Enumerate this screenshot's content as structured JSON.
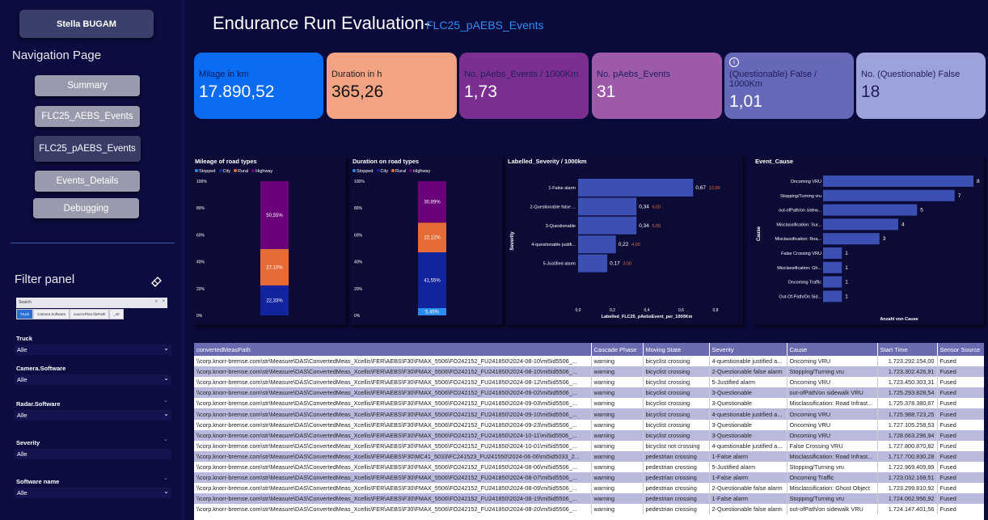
{
  "user": {
    "name": "Stella BUGAM"
  },
  "navigation": {
    "title": "Navigation Page",
    "items": [
      "Summary",
      "FLC25_AEBS_Events",
      "FLC25_pAEBS_Events",
      "Events_Details",
      "Debugging"
    ]
  },
  "header": {
    "title": "Endurance Run Evaluation-",
    "subtitle": "FLC25_pAEBS_Events"
  },
  "kpis": [
    {
      "label": "Milage in km",
      "value": "17.890,52",
      "color": "#0a6cf0"
    },
    {
      "label": "Duration in h",
      "value": "365,26",
      "color": "#f2a383"
    },
    {
      "label": "No. pAebs_Events / 1000Km",
      "value": "1,73",
      "color": "#7b2f90"
    },
    {
      "label": "No. pAebs_Events",
      "value": "31",
      "color": "#9d5aa9"
    },
    {
      "label": "(Questionable) False / 1000Km",
      "value": "1,01",
      "color": "#6669b9"
    },
    {
      "label": "No. (Questionable) False",
      "value": "18",
      "color": "#9ca2da"
    }
  ],
  "filters": {
    "title": "Filter panel",
    "search_placeholder": "Search",
    "chips": [
      "Truck",
      "Camera.Software",
      "sourceFiles.filePath",
      "_str"
    ],
    "fields": [
      {
        "label": "Truck",
        "value": "Alle"
      },
      {
        "label": "Camera.Software",
        "value": "Alle"
      },
      {
        "label": "Radar.Software",
        "value": "Alle"
      },
      {
        "label": "Severity",
        "value": "Alle"
      },
      {
        "label": "Software name",
        "value": "Alle"
      }
    ]
  },
  "colors": {
    "stopped": "#2b8cf0",
    "city": "#12239e",
    "rural": "#e66c37",
    "highway": "#6b007b",
    "bar": "#3c4fb3"
  },
  "chart_data": [
    {
      "type": "bar",
      "title": "Mileage of road types",
      "legend": [
        "Stopped",
        "City",
        "Rural",
        "Highway"
      ],
      "yticks": [
        "0%",
        "20%",
        "40%",
        "60%",
        "80%",
        "100%"
      ],
      "series": [
        {
          "name": "Stopped",
          "value": 0
        },
        {
          "name": "City",
          "value": 22.33,
          "label": "22,33%"
        },
        {
          "name": "Rural",
          "value": 27.1,
          "label": "27,10%"
        },
        {
          "name": "Highway",
          "value": 50.55,
          "label": "50,55%"
        }
      ]
    },
    {
      "type": "bar",
      "title": "Duration on road types",
      "legend": [
        "Stopped",
        "City",
        "Rural",
        "Highway"
      ],
      "yticks": [
        "0%",
        "20%",
        "40%",
        "60%",
        "80%",
        "100%"
      ],
      "series": [
        {
          "name": "Stopped",
          "value": 5.45,
          "label": "5,45%"
        },
        {
          "name": "City",
          "value": 41.55,
          "label": "41,55%"
        },
        {
          "name": "Rural",
          "value": 22.12,
          "label": "22,12%"
        },
        {
          "name": "Highway",
          "value": 30.89,
          "label": "30,89%"
        }
      ]
    },
    {
      "type": "bar",
      "title": "Labelled_Severity / 1000km",
      "xlabel": "Labelled_FLC25_pAebsEvent_per_1000Km",
      "ylabel": "Severity",
      "xlim": [
        0,
        0.8
      ],
      "xticks": [
        "0,0",
        "0,2",
        "0,4",
        "0,6",
        "0,8"
      ],
      "categories": [
        "1-False alarm",
        "2-Questionable false ...",
        "3-Questionable",
        "4-questionable justifi...",
        "5-Justified alarm"
      ],
      "values": [
        0.67,
        0.34,
        0.34,
        0.22,
        0.17
      ],
      "labels": [
        "0,67",
        "0,34",
        "0,34",
        "0,22",
        "0,17"
      ],
      "secondary_labels": [
        "12,00",
        "6,00",
        "6,00",
        "4,00",
        "3,00"
      ]
    },
    {
      "type": "bar",
      "title": "Event_Cause",
      "xlabel": "Anzahl von Cause",
      "ylabel": "Cause",
      "xlim": [
        0,
        8
      ],
      "categories": [
        "Oncoming VRU",
        "Stopping/Turning vru",
        "out-ofPath/on sidew...",
        "Misclassification: Sur...",
        "Misclassification: Roa...",
        "False Crossing VRU",
        "Misclassification: Gh...",
        "Oncoming Traffic",
        "Out-Of-Path/On Sid..."
      ],
      "values": [
        8,
        7,
        5,
        4,
        3,
        1,
        1,
        1,
        1
      ]
    }
  ],
  "table": {
    "columns": [
      "convertedMeasPath",
      "Cascade Phase",
      "Moving State",
      "Severity",
      "Cause",
      "Start Time",
      "Sensor Source"
    ],
    "rows": [
      [
        "\\\\corp.knorr-bremse.com\\str\\Measure\\DAS\\ConvertedMeas_Xcellis\\FER\\AEBS\\F30\\FMAX_5506\\FO242152_FU241850\\2024-08-10\\mi5id5506_...",
        "warning",
        "bicyclist crossing",
        "4-questionable justified a...",
        "Oncoming VRU",
        "1.723.292.154,00",
        "Fused"
      ],
      [
        "\\\\corp.knorr-bremse.com\\str\\Measure\\DAS\\ConvertedMeas_Xcellis\\FER\\AEBS\\F30\\FMAX_5506\\FO242152_FU241850\\2024-08-10\\mi5id5506_...",
        "warning",
        "bicyclist crossing",
        "2-Questionable false alarm",
        "Stopping/Turning vru",
        "1.723.302.426,91",
        "Fused"
      ],
      [
        "\\\\corp.knorr-bremse.com\\str\\Measure\\DAS\\ConvertedMeas_Xcellis\\FER\\AEBS\\F30\\FMAX_5506\\FO242152_FU241850\\2024-08-12\\mi5id5506_...",
        "warning",
        "bicyclist crossing",
        "5-Justified alarm",
        "Oncoming VRU",
        "1.723.450.303,31",
        "Fused"
      ],
      [
        "\\\\corp.knorr-bremse.com\\str\\Measure\\DAS\\ConvertedMeas_Xcellis\\FER\\AEBS\\F30\\FMAX_5506\\FO242152_FU241850\\2024-09-02\\mi5id5506_...",
        "warning",
        "bicyclist crossing",
        "3-Questionable",
        "out-ofPath/on sidewalk VRU",
        "1.725.293.828,54",
        "Fused"
      ],
      [
        "\\\\corp.knorr-bremse.com\\str\\Measure\\DAS\\ConvertedMeas_Xcellis\\FER\\AEBS\\F30\\FMAX_5506\\FO242152_FU241850\\2024-09-03\\mi5id5506_...",
        "warning",
        "bicyclist crossing",
        "3-Questionable",
        "Misclassification: Road Infrast...",
        "1.725.378.380,67",
        "Fused"
      ],
      [
        "\\\\corp.knorr-bremse.com\\str\\Measure\\DAS\\ConvertedMeas_Xcellis\\FER\\AEBS\\F30\\FMAX_5506\\FO242152_FU241850\\2024-09-10\\mi5id5506_...",
        "warning",
        "bicyclist crossing",
        "4-questionable justified a...",
        "Oncoming VRU",
        "1.725.988.723,25",
        "Fused"
      ],
      [
        "\\\\corp.knorr-bremse.com\\str\\Measure\\DAS\\ConvertedMeas_Xcellis\\FER\\AEBS\\F30\\FMAX_5506\\FO242152_FU241850\\2024-09-23\\mi5id5506_...",
        "warning",
        "bicyclist crossing",
        "3-Questionable",
        "Oncoming VRU",
        "1.727.105.258,53",
        "Fused"
      ],
      [
        "\\\\corp.knorr-bremse.com\\str\\Measure\\DAS\\ConvertedMeas_Xcellis\\FER\\AEBS\\F30\\FMAX_5506\\FO242152_FU241850\\2024-10-11\\mi5id5506_...",
        "warning",
        "bicyclist crossing",
        "3-Questionable",
        "Oncoming VRU",
        "1.728.663.296,94",
        "Fused"
      ],
      [
        "\\\\corp.knorr-bremse.com\\str\\Measure\\DAS\\ConvertedMeas_Xcellis\\FER\\AEBS\\F30\\FMAX_5506\\FO242152_FU241850\\2024-10-01\\mi5id5506_...",
        "warning",
        "bicyclist not crossing",
        "4-questionable justified a...",
        "False Crossing VRU",
        "1.727.800.870,82",
        "Fused"
      ],
      [
        "\\\\corp.knorr-bremse.com\\str\\Measure\\DAS\\ConvertedMeas_Xcellis\\FER\\AEBS\\F30\\MC41_5033\\FC241523_FU241550\\2024-06-06\\mi5id5033_2...",
        "warning",
        "pedestrian crossing",
        "1-False alarm",
        "Misclassification: Road Infrast...",
        "1.717.700.830,28",
        "Fused"
      ],
      [
        "\\\\corp.knorr-bremse.com\\str\\Measure\\DAS\\ConvertedMeas_Xcellis\\FER\\AEBS\\F30\\FMAX_5506\\FO242152_FU241850\\2024-08-06\\mi5id5506_...",
        "warning",
        "pedestrian crossing",
        "5-Justified alarm",
        "Stopping/Turning vru",
        "1.722.969.409,99",
        "Fused"
      ],
      [
        "\\\\corp.knorr-bremse.com\\str\\Measure\\DAS\\ConvertedMeas_Xcellis\\FER\\AEBS\\F30\\FMAX_5506\\FO242152_FU241850\\2024-08-07\\mi5id5506_...",
        "warning",
        "pedestrian crossing",
        "1-False alarm",
        "Oncoming Traffic",
        "1.723.032.168,51",
        "Fused"
      ],
      [
        "\\\\corp.knorr-bremse.com\\str\\Measure\\DAS\\ConvertedMeas_Xcellis\\FER\\AEBS\\F30\\FMAX_5506\\FO242152_FU241850\\2024-08-09\\mi5id5506_...",
        "warning",
        "pedestrian crossing",
        "2-Questionable false alarm",
        "Misclassification: Ghost Object",
        "1.723.299.810,92",
        "Fused"
      ],
      [
        "\\\\corp.knorr-bremse.com\\str\\Measure\\DAS\\ConvertedMeas_Xcellis\\FER\\AEBS\\F30\\FMAX_5506\\FO242152_FU241850\\2024-08-19\\mi5id5506_...",
        "warning",
        "pedestrian crossing",
        "1-False alarm",
        "Stopping/Turning vru",
        "1.724.062.956,92",
        "Fused"
      ],
      [
        "\\\\corp.knorr-bremse.com\\str\\Measure\\DAS\\ConvertedMeas_Xcellis\\FER\\AEBS\\F30\\FMAX_5506\\FO242152_FU241850\\2024-08-20\\mi5id5506_...",
        "warning",
        "pedestrian crossing",
        "2-Questionable false alarm",
        "out-ofPath/on sidewalk VRU",
        "1.724.147.401,56",
        "Fused"
      ]
    ]
  }
}
